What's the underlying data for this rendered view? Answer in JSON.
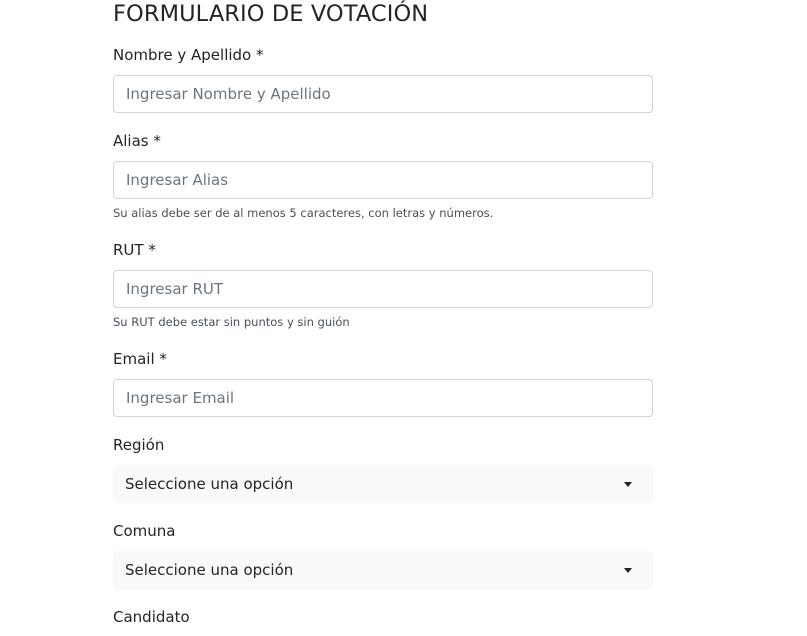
{
  "form": {
    "title": "FORMULARIO DE VOTACIÓN",
    "name": {
      "label": "Nombre y Apellido *",
      "placeholder": "Ingresar Nombre y Apellido",
      "value": ""
    },
    "alias": {
      "label": "Alias *",
      "placeholder": "Ingresar Alias",
      "value": "",
      "help": "Su alias debe ser de al menos 5 caracteres, con letras y números."
    },
    "rut": {
      "label": "RUT *",
      "placeholder": "Ingresar RUT",
      "value": "",
      "help": "Su RUT debe estar sin puntos y sin guión"
    },
    "email": {
      "label": "Email *",
      "placeholder": "Ingresar Email",
      "value": ""
    },
    "region": {
      "label": "Región",
      "selected": "Seleccione una opción"
    },
    "comuna": {
      "label": "Comuna",
      "selected": "Seleccione una opción"
    },
    "candidato": {
      "label": "Candidato"
    }
  }
}
